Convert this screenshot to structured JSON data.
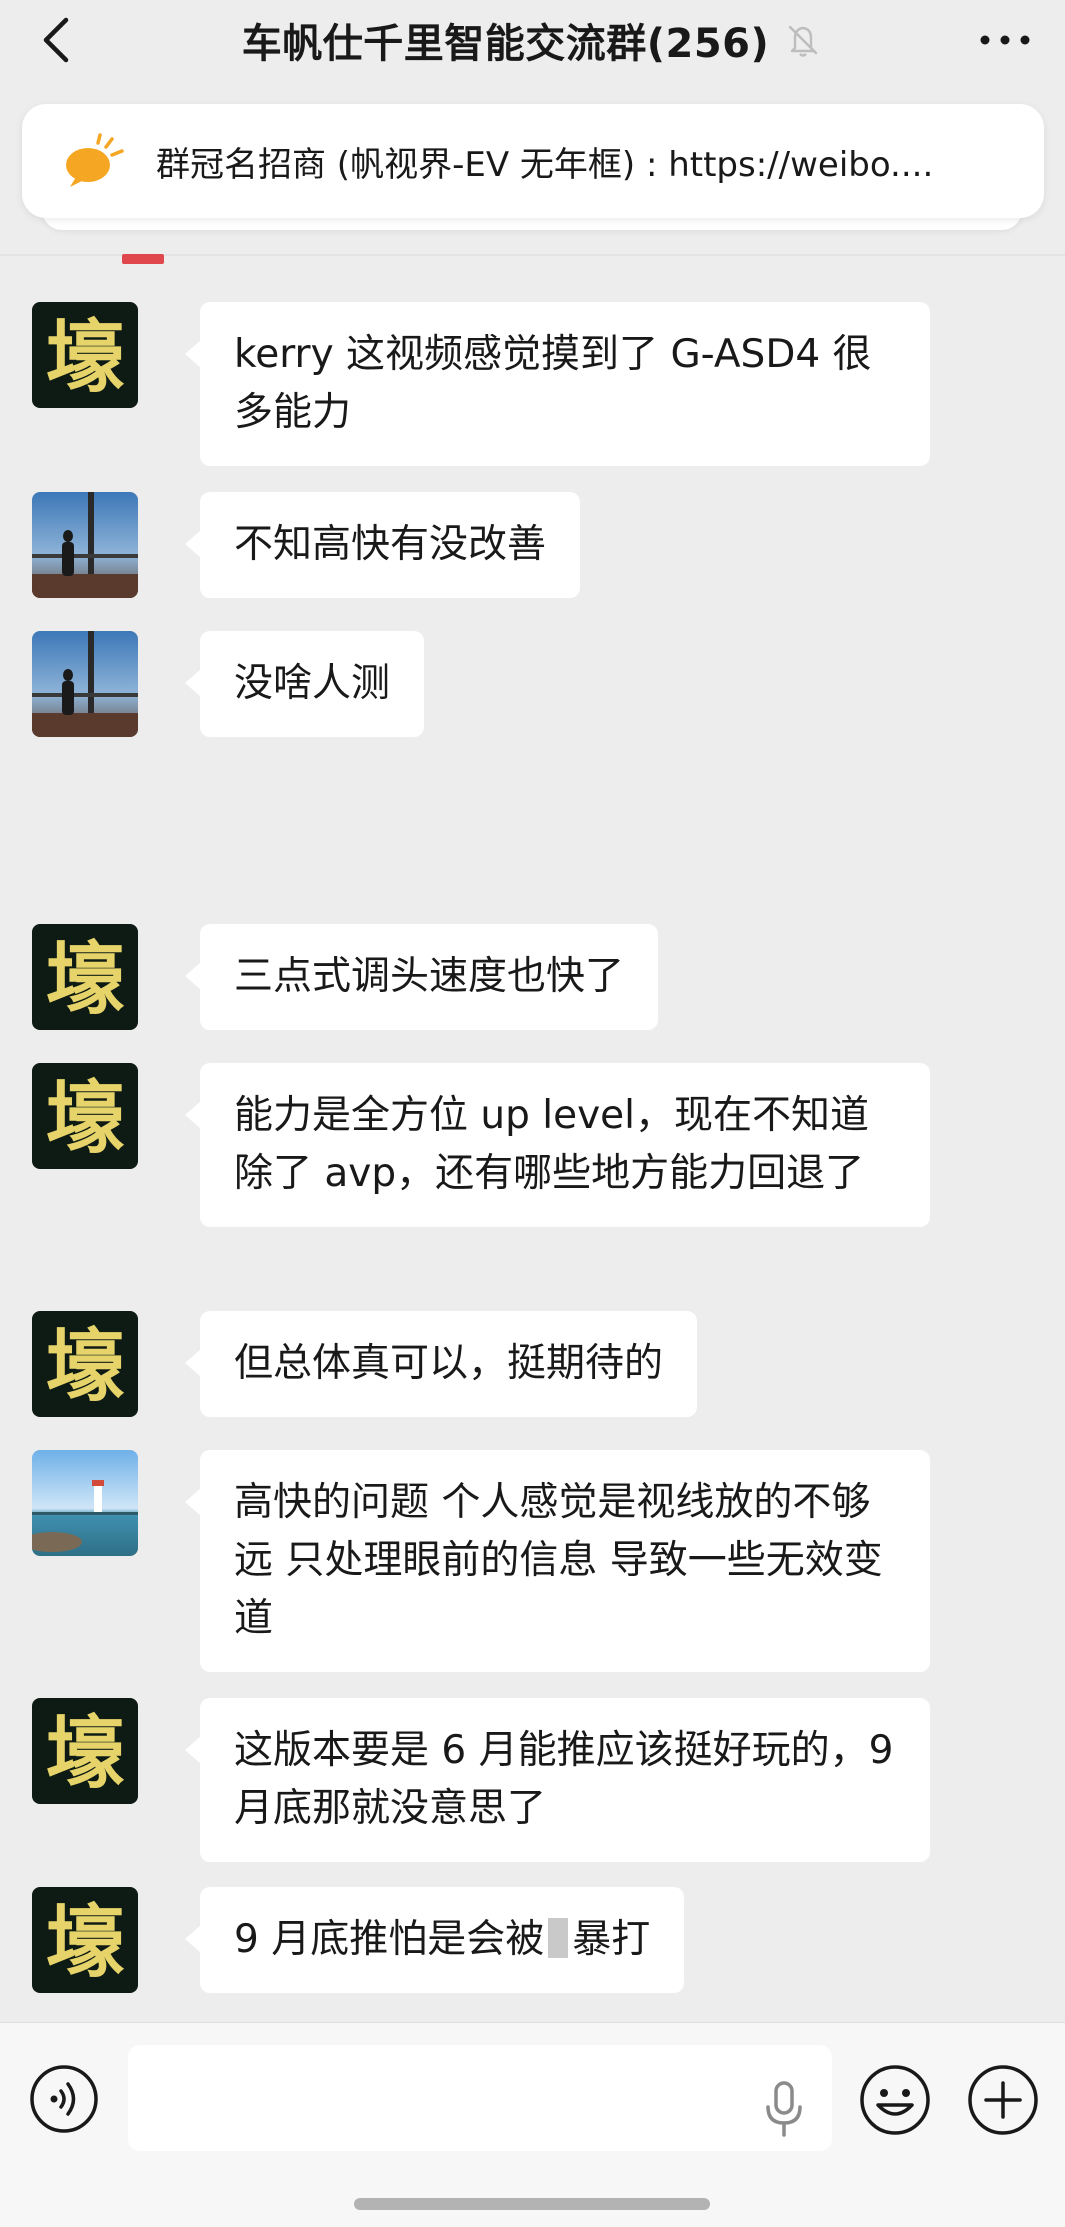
{
  "header": {
    "title": "车帆仕千里智能交流群(256)",
    "back_icon": "chevron-left-icon",
    "mute_icon": "bell-muted-icon",
    "more_icon": "more-horizontal-icon"
  },
  "pinned": {
    "icon": "announcement-speech-icon",
    "text": "群冠名招商 (帆视界-EV 无年框) : https://weibo...."
  },
  "avatar_glyph": "壕",
  "messages": [
    {
      "avatar": "glyph",
      "text": "kerry 这视频感觉摸到了 G-ASD4 很多能力"
    },
    {
      "avatar": "photo-balcony",
      "text": "不知高快有没改善"
    },
    {
      "avatar": "photo-balcony",
      "text": "没啥人测"
    },
    {
      "avatar": "glyph",
      "text": "三点式调头速度也快了"
    },
    {
      "avatar": "glyph",
      "text": "能力是全方位 up level，现在不知道除了 avp，还有哪些地方能力回退了"
    },
    {
      "avatar": "glyph",
      "text": "但总体真可以，挺期待的"
    },
    {
      "avatar": "photo-lighthouse",
      "text": "高快的问题 个人感觉是视线放的不够远 只处理眼前的信息 导致一些无效变道"
    },
    {
      "avatar": "glyph",
      "text": "这版本要是 6 月能推应该挺好玩的，9 月底那就没意思了"
    },
    {
      "avatar": "glyph",
      "text_before": "9 月底推怕是会被",
      "text_after": "暴打"
    }
  ],
  "input_bar": {
    "voice_icon": "voice-mode-icon",
    "mic_icon": "microphone-icon",
    "emoji_icon": "emoji-smile-icon",
    "plus_icon": "plus-circle-icon"
  },
  "colors": {
    "background": "#ededed",
    "bubble": "#ffffff",
    "text": "#191919",
    "glyph_avatar_bg": "#0e1a14",
    "glyph_avatar_fg": "#e6d46a",
    "announcement_icon": "#f5a623"
  }
}
